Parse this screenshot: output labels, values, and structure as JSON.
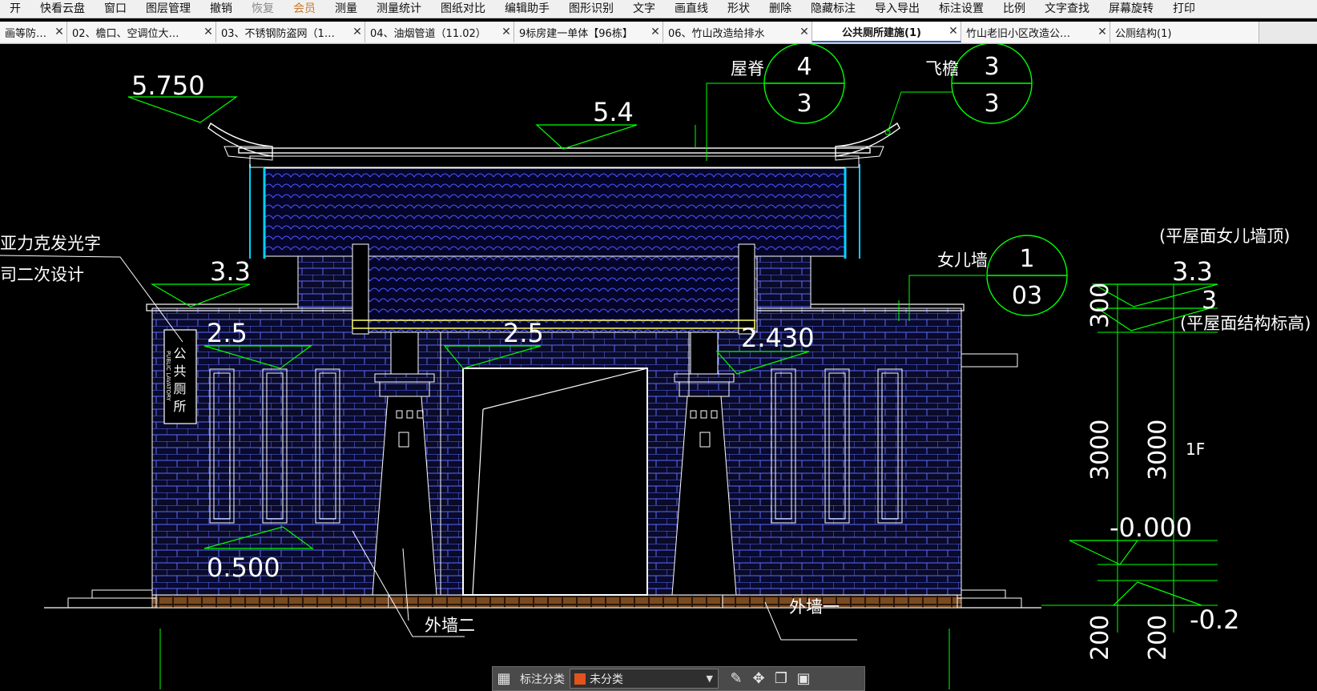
{
  "menu": [
    {
      "label": "开",
      "state": "normal"
    },
    {
      "label": "快看云盘",
      "state": "normal"
    },
    {
      "label": "窗口",
      "state": "normal"
    },
    {
      "label": "图层管理",
      "state": "normal"
    },
    {
      "label": "撤销",
      "state": "normal"
    },
    {
      "label": "恢复",
      "state": "disabled"
    },
    {
      "label": "会员",
      "state": "vip"
    },
    {
      "label": "测量",
      "state": "normal"
    },
    {
      "label": "测量统计",
      "state": "normal"
    },
    {
      "label": "图纸对比",
      "state": "normal"
    },
    {
      "label": "编辑助手",
      "state": "normal"
    },
    {
      "label": "图形识别",
      "state": "normal"
    },
    {
      "label": "文字",
      "state": "normal"
    },
    {
      "label": "画直线",
      "state": "normal"
    },
    {
      "label": "形状",
      "state": "normal"
    },
    {
      "label": "删除",
      "state": "normal"
    },
    {
      "label": "隐藏标注",
      "state": "normal"
    },
    {
      "label": "导入导出",
      "state": "normal"
    },
    {
      "label": "标注设置",
      "state": "normal"
    },
    {
      "label": "比例",
      "state": "normal"
    },
    {
      "label": "文字查找",
      "state": "normal"
    },
    {
      "label": "屏幕旋转",
      "state": "normal"
    },
    {
      "label": "打印",
      "state": "normal"
    }
  ],
  "tabs": [
    {
      "label": "画等防…",
      "active": false
    },
    {
      "label": "02、檐口、空调位大…",
      "active": false
    },
    {
      "label": "03、不锈钢防盗网（1…",
      "active": false
    },
    {
      "label": "04、油烟管道（11.02）",
      "active": false
    },
    {
      "label": "9标房建一单体【96栋】",
      "active": false
    },
    {
      "label": "06、竹山改造给排水",
      "active": false
    },
    {
      "label": "公共厕所建施(1)",
      "active": true
    },
    {
      "label": "竹山老旧小区改造公…",
      "active": false
    },
    {
      "label": "公厕结构(1)",
      "active": false
    }
  ],
  "drawing": {
    "elev_5750": "5.750",
    "elev_54": "5.4",
    "elev_33_left": "3.3",
    "elev_25_left": "2.5",
    "elev_25_mid": "2.5",
    "elev_2430": "2.430",
    "elev_0500": "0.500",
    "elev_33_right": "3.3",
    "elev_3_right": "3",
    "elev_0000": "-0.000",
    "elev_neg02": "-0.2",
    "label_wuji": "屋脊",
    "label_feiyan": "飞檐",
    "label_nvqiang": "女儿墙",
    "label_pingwu_top": "(平屋面女儿墙顶)",
    "label_pingwu_struct": "(平屋面结构标高)",
    "label_yakeli": "亚力克发光字",
    "label_erci": "司二次设计",
    "sign_cn": "公共厕所",
    "sign_en": "PUBLIC LAVATORY",
    "label_waiqiang2": "外墙二",
    "label_waiqiang1": "外墙一",
    "dim_300": "300",
    "dim_3000_a": "3000",
    "dim_3000_b": "3000",
    "dim_200_a": "200",
    "dim_200_b": "200",
    "label_1f": "1F",
    "bubble_1_top": "4",
    "bubble_1_bottom": "3",
    "bubble_2_top": "3",
    "bubble_2_bottom": "3",
    "bubble_3_top": "1",
    "bubble_3_bottom": "03"
  },
  "bottom_toolbar": {
    "label": "标注分类",
    "select_value": "未分类",
    "swatch_color": "#e2531b"
  },
  "colors": {
    "canvas_bg": "#000000",
    "cad_green": "#00ff00",
    "cad_white": "#ffffff",
    "cad_blue": "#3b4cff",
    "cad_cyan": "#00d2ff",
    "cad_yellow": "#ffff66",
    "cad_brick": "#8a5a2b"
  }
}
